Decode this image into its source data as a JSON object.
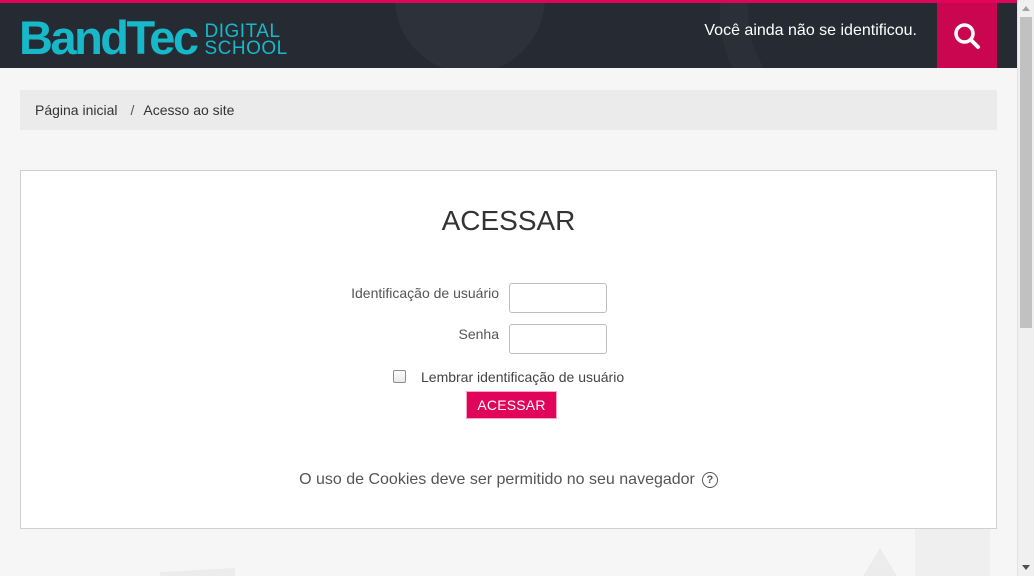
{
  "header": {
    "logo_main": "BandTec",
    "logo_line1": "DIGITAL",
    "logo_line2": "SCHOOL",
    "login_status": "Você ainda não se identificou.",
    "search_icon": "search-icon"
  },
  "breadcrumb": {
    "home": "Página inicial",
    "separator": "/",
    "current": "Acesso ao site"
  },
  "login": {
    "title": "ACESSAR",
    "username_label": "Identificação de usuário",
    "username_value": "",
    "password_label": "Senha",
    "password_value": "",
    "remember_label": "Lembrar identificação de usuário",
    "remember_checked": false,
    "submit_label": "ACESSAR",
    "cookies_text": "O uso de Cookies deve ser permitido no seu navegador",
    "help_icon": "help-icon",
    "help_glyph": "?"
  },
  "colors": {
    "accent": "#e0055a",
    "header_bg": "#262b33",
    "logo": "#17b8c9",
    "search_bg": "#c9064f"
  }
}
